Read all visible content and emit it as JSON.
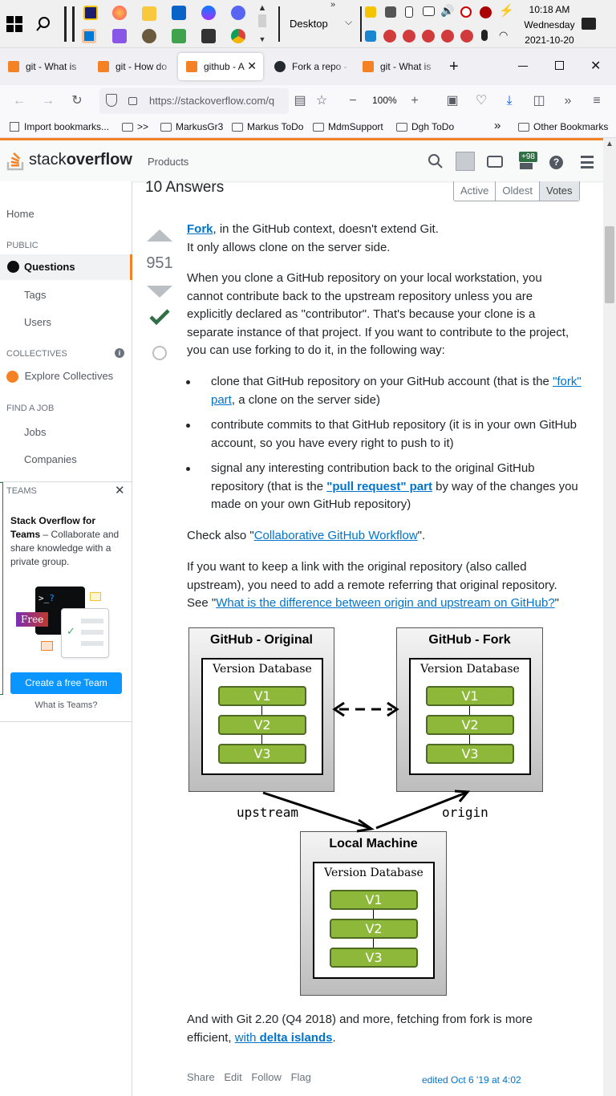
{
  "taskbar": {
    "desktop_label": "Desktop",
    "clock_time": "10:18 AM",
    "clock_day": "Wednesday",
    "clock_date": "2021-10-20"
  },
  "browser": {
    "tabs": [
      {
        "label": "git - What is"
      },
      {
        "label": "git - How do"
      },
      {
        "label": "github - A"
      },
      {
        "label": "Fork a repo -"
      },
      {
        "label": "git - What is"
      }
    ],
    "new_tab": "+",
    "url": "https://stackoverflow.com/q",
    "zoom": "100%",
    "bookmarks": [
      {
        "label": "Import bookmarks..."
      },
      {
        "label": ">>"
      },
      {
        "label": "MarkusGr3"
      },
      {
        "label": "Markus ToDo"
      },
      {
        "label": "MdmSupport"
      },
      {
        "label": "Dgh ToDo"
      },
      {
        "label": "Other Bookmarks"
      }
    ]
  },
  "so": {
    "logo_light": "stack",
    "logo_bold": "overflow",
    "products": "Products",
    "rep_badge": "+98",
    "brand_color": "#f48225"
  },
  "sidebar": {
    "home": "Home",
    "public": "PUBLIC",
    "questions": "Questions",
    "tags": "Tags",
    "users": "Users",
    "collectives": "COLLECTIVES",
    "explore": "Explore Collectives",
    "find_job": "FIND A JOB",
    "jobs": "Jobs",
    "companies": "Companies",
    "teams": "TEAMS",
    "teams_title": "Stack Overflow for Teams",
    "teams_rest": "– Collaborate and share knowledge with a private group.",
    "free_badge": "Free",
    "create_team": "Create a free Team",
    "what_is_teams": "What is Teams?"
  },
  "answers": {
    "count": "10 Answers",
    "sort": [
      "Active",
      "Oldest",
      "Votes"
    ],
    "votes": "951",
    "p1_link": "Fork",
    "p1_rest": ", in the GitHub context, doesn't extend Git.",
    "p1_line2": "It only allows clone on the server side.",
    "p2": "When you clone a GitHub repository on your local workstation, you cannot contribute back to the upstream repository unless you are explicitly declared as \"contributor\". That's because your clone is a separate instance of that project. If you want to contribute to the project, you can use forking to do it, in the following way:",
    "b1_a": "clone that GitHub repository on your GitHub account (that is the",
    "b1_link": "\"fork\" part",
    "b1_b": ", a clone on the server side)",
    "b2": "contribute commits to that GitHub repository (it is in your own GitHub account, so you have every right to push to it)",
    "b3_a": "signal any interesting contribution back to the original GitHub repository (that is the ",
    "b3_link": "\"pull request\" part",
    "b3_b": " by way of the changes you made on your own GitHub repository)",
    "p3_a": "Check also \"",
    "p3_link": "Collaborative GitHub Workflow",
    "p3_b": "\".",
    "p4_a": "If you want to keep a link with the original repository (also called upstream), you need to add a remote referring that original repository. See \"",
    "p4_link": "What is the difference between origin and upstream on GitHub?",
    "p4_b": "\"",
    "p5_a": "And with Git 2.20 (Q4 2018) and more, fetching from fork is more efficient, ",
    "p5_link_a": "with ",
    "p5_link_b": "delta islands",
    "p5_b": ".",
    "actions": [
      "Share",
      "Edit",
      "Follow",
      "Flag"
    ],
    "edited": "edited Oct 6 '19 at 4:02"
  },
  "diagram": {
    "original": "GitHub - Original",
    "fork": "GitHub - Fork",
    "local": "Local Machine",
    "db": "Version Database",
    "versions": [
      "V1",
      "V2",
      "V3"
    ],
    "upstream": "upstream",
    "origin": "origin"
  }
}
